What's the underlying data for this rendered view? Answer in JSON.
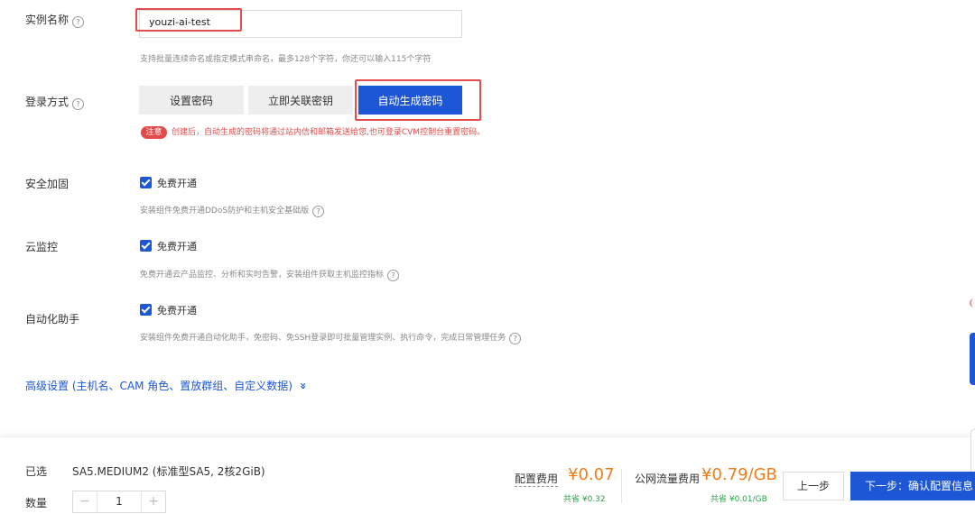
{
  "instance_name": {
    "label": "实例名称",
    "value": "youzi-ai-test",
    "hint": "支持批量连续命名或指定模式串命名，最多128个字符，你还可以输入115个字符"
  },
  "login": {
    "label": "登录方式",
    "options": [
      "设置密码",
      "立即关联密钥",
      "自动生成密码"
    ],
    "selected": "自动生成密码",
    "notice_tag": "注意",
    "notice_text": "创建后，自动生成的密码将通过站内信和邮箱发送给您,也可登录CVM控制台重置密码。"
  },
  "security": {
    "label": "安全加固",
    "checkbox_label": "免费开通",
    "hint": "安装组件免费开通DDoS防护和主机安全基础版"
  },
  "monitoring": {
    "label": "云监控",
    "checkbox_label": "免费开通",
    "hint": "免费开通云产品监控、分析和实时告警，安装组件获取主机监控指标"
  },
  "automation": {
    "label": "自动化助手",
    "checkbox_label": "免费开通",
    "hint": "安装组件免费开通自动化助手，免密码、免SSH登录即可批量管理实例、执行命令，完成日常管理任务"
  },
  "advanced": {
    "label": "高级设置 (主机名、CAM 角色、置放群组、自定义数据)",
    "chevron": "»"
  },
  "footer": {
    "selected_label": "已选",
    "selected_value": "SA5.MEDIUM2 (标准型SA5, 2核2GiB)",
    "quantity_label": "数量",
    "quantity_value": "1",
    "minus": "−",
    "plus": "+",
    "config_fee_label": "配置费用",
    "config_fee_value": "¥0.07",
    "config_save": "共省 ¥0.32",
    "traffic_fee_label": "公网流量费用",
    "traffic_fee_value": "¥0.79/GB",
    "traffic_save": "共省 ¥0.01/GB",
    "prev_label": "上一步",
    "next_label": "下一步：确认配置信息"
  },
  "help_icon": "?",
  "colors": {
    "accent": "#1e57d5",
    "price": "#f07d1a",
    "saving": "#2aa34a",
    "warning": "#e14b4b",
    "highlight_box": "#e34d4d"
  }
}
